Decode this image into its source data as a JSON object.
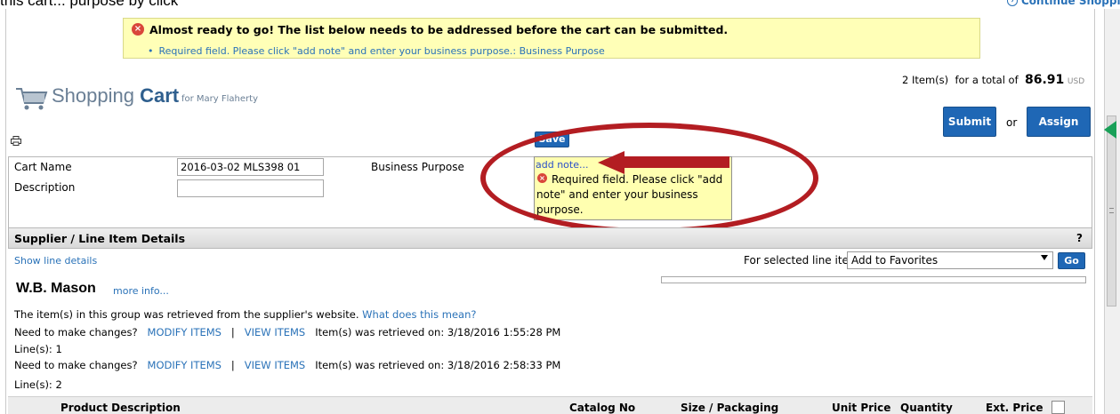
{
  "top_caption": "this cart... purpose by clicking add note...",
  "continue_shopping": "Continue Shopping",
  "error": {
    "title": "Almost ready to go! The list below needs to be addressed before the cart can be submitted.",
    "bullet": "Required field. Please click \"add note\" and enter your business purpose.: Business Purpose"
  },
  "cart": {
    "title_light": "Shopping ",
    "title_bold": "Cart",
    "for_user": "for Mary Flaherty",
    "items_count": "2 Item(s)",
    "total_label": "for a total of",
    "total_amount": "86.91",
    "currency": "USD"
  },
  "actions": {
    "submit": "Submit",
    "or": "or",
    "assign": "Assign Cart",
    "save": "Save"
  },
  "form": {
    "cart_name_label": "Cart Name",
    "cart_name_value": "2016-03-02 MLS398 01",
    "description_label": "Description",
    "description_value": "",
    "business_purpose_label": "Business Purpose",
    "add_note": "add note...",
    "note_error": "Required field. Please click \"add note\" and enter your business purpose."
  },
  "supplier_section": {
    "header": "Supplier / Line Item Details",
    "help": "?",
    "show_line_details": "Show line details",
    "for_selected": "For selected line items",
    "selected_action": "Add to Favorites",
    "go": "Go",
    "progress": 0
  },
  "supplier": {
    "name": "W.B. Mason",
    "more_info": "more info...",
    "retrieved_note": "The item(s) in this group was retrieved from the supplier's website.",
    "what_does_this_mean": "What does this mean?",
    "groups": [
      {
        "need_changes": "Need to make changes?",
        "modify": "MODIFY ITEMS",
        "sep": "|",
        "view": "VIEW ITEMS",
        "retrieved": "Item(s) was retrieved on: 3/18/2016 1:55:28 PM",
        "lines": "Line(s): 1"
      },
      {
        "need_changes": "Need to make changes?",
        "modify": "MODIFY ITEMS",
        "sep": "|",
        "view": "VIEW ITEMS",
        "retrieved": "Item(s) was retrieved on: 3/18/2016 2:58:33 PM",
        "lines": "Line(s): 2"
      }
    ]
  },
  "table": {
    "columns": [
      "Product Description",
      "Catalog No",
      "Size / Packaging",
      "Unit Price",
      "Quantity",
      "Ext. Price"
    ]
  },
  "colors": {
    "accent_blue": "#1f67b5",
    "link_blue": "#2a72b8",
    "error_yellow": "#ffffb7",
    "annotation_red": "#b31d22",
    "annotation_green": "#19a058"
  }
}
